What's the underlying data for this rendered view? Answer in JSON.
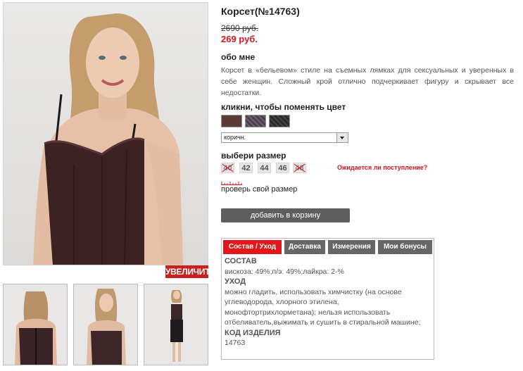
{
  "product": {
    "title": "Корсет(№14763)",
    "old_price": "2690 руб.",
    "new_price": "269 руб.",
    "about_heading": "обо мне",
    "description": "Корсет в «бельевом» стиле на съемных лямках для сексуальных и уверенных в себе женщин. Сложный крой отлично подчеркивает фигуру и скрывает все недостатки."
  },
  "gallery": {
    "zoom_label": "УВЕЛИЧИТЬ",
    "main_photo": "model-front-photo",
    "thumbnails": [
      "back-view",
      "front-view",
      "full-length-view"
    ]
  },
  "color": {
    "heading": "кликни, чтобы поменять цвет",
    "swatches": [
      {
        "name": "brown",
        "hex": "#5a3a36"
      },
      {
        "name": "purple-print",
        "hex": "#4b3f4d"
      },
      {
        "name": "black-print",
        "hex": "#2c2a2d"
      }
    ],
    "selected": "коричн."
  },
  "size": {
    "heading": "выбери размер",
    "options": [
      {
        "label": "40",
        "available": false
      },
      {
        "label": "42",
        "available": true
      },
      {
        "label": "44",
        "available": true
      },
      {
        "label": "46",
        "available": true
      },
      {
        "label": "48",
        "available": false
      }
    ],
    "waiting_link": "Ожидается ли поступление?",
    "check_size": "проверь свой размер"
  },
  "cart": {
    "button_label": "добавить в корзину"
  },
  "tabs": {
    "items": [
      "Состав / Уход",
      "Доставка",
      "Измерения",
      "Мои бонусы"
    ],
    "active": "Состав / Уход"
  },
  "composition": {
    "h1": "СОСТАВ",
    "t1": "вискоза: 49%;п/э: 49%;лайкра: 2-%",
    "h2": "УХОД",
    "t2": "можно гладить, использовать химчистку (на основе углеводорода, хлорного этилена, монофтортрихлорметана); нельзя использовать отбеливатель,выжимать и сушить в стиральной машине;",
    "h3": "КОД ИЗДЕЛИЯ",
    "t3": "14763"
  },
  "colors": {
    "accent": "#e3161b",
    "price_red": "#d9141e",
    "button_gray": "#5e5e5e"
  }
}
